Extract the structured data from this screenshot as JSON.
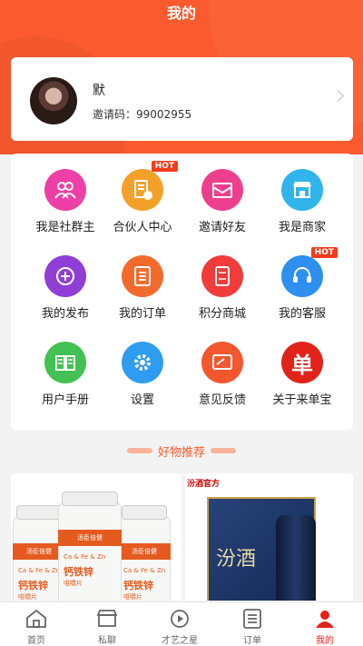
{
  "page": {
    "title": "我的"
  },
  "profile": {
    "name": "默",
    "invite_label": "邀请码：",
    "invite_code": "99002955"
  },
  "menu": [
    {
      "label": "我是社群主",
      "icon": "group-icon",
      "color": "#ee3fa6"
    },
    {
      "label": "合伙人中心",
      "icon": "partner-doc-icon",
      "color": "#f4a12a",
      "badge": "HOT"
    },
    {
      "label": "邀请好友",
      "icon": "envelope-icon",
      "color": "#ee3f8f"
    },
    {
      "label": "我是商家",
      "icon": "shop-icon",
      "color": "#2fb5ec"
    },
    {
      "label": "我的发布",
      "icon": "add-circle-icon",
      "color": "#8f3fd6"
    },
    {
      "label": "我的订单",
      "icon": "order-list-icon",
      "color": "#f26b2d"
    },
    {
      "label": "积分商城",
      "icon": "coupon-icon",
      "color": "#f23b3b"
    },
    {
      "label": "我的客服",
      "icon": "headset-icon",
      "color": "#2e8ff0",
      "badge": "HOT"
    },
    {
      "label": "用户手册",
      "icon": "book-icon",
      "color": "#43c152"
    },
    {
      "label": "设置",
      "icon": "gear-icon",
      "color": "#2e9cf0"
    },
    {
      "label": "意见反馈",
      "icon": "feedback-edit-icon",
      "color": "#f2572d"
    },
    {
      "label": "关于来单宝",
      "icon": "dan-logo-icon",
      "color": "#e2231a",
      "glyph": "单"
    }
  ],
  "recommend": {
    "title": "好物推荐"
  },
  "products": [
    {
      "brand": "汤臣倍健",
      "line1": "Ca & Fe & Zn",
      "name": "钙铁锌",
      "sub": "咀嚼片"
    },
    {
      "shop": "汾酒官方",
      "name": "汾酒"
    }
  ],
  "tabs": [
    {
      "label": "首页",
      "icon": "home-icon",
      "active": false
    },
    {
      "label": "私聊",
      "icon": "chat-icon",
      "active": false
    },
    {
      "label": "才艺之星",
      "icon": "play-circle-icon",
      "active": false
    },
    {
      "label": "订单",
      "icon": "order-icon",
      "active": false
    },
    {
      "label": "我的",
      "icon": "person-icon",
      "active": true
    }
  ],
  "colors": {
    "brand": "#fb5a2e",
    "active_tab": "#e2231a"
  }
}
